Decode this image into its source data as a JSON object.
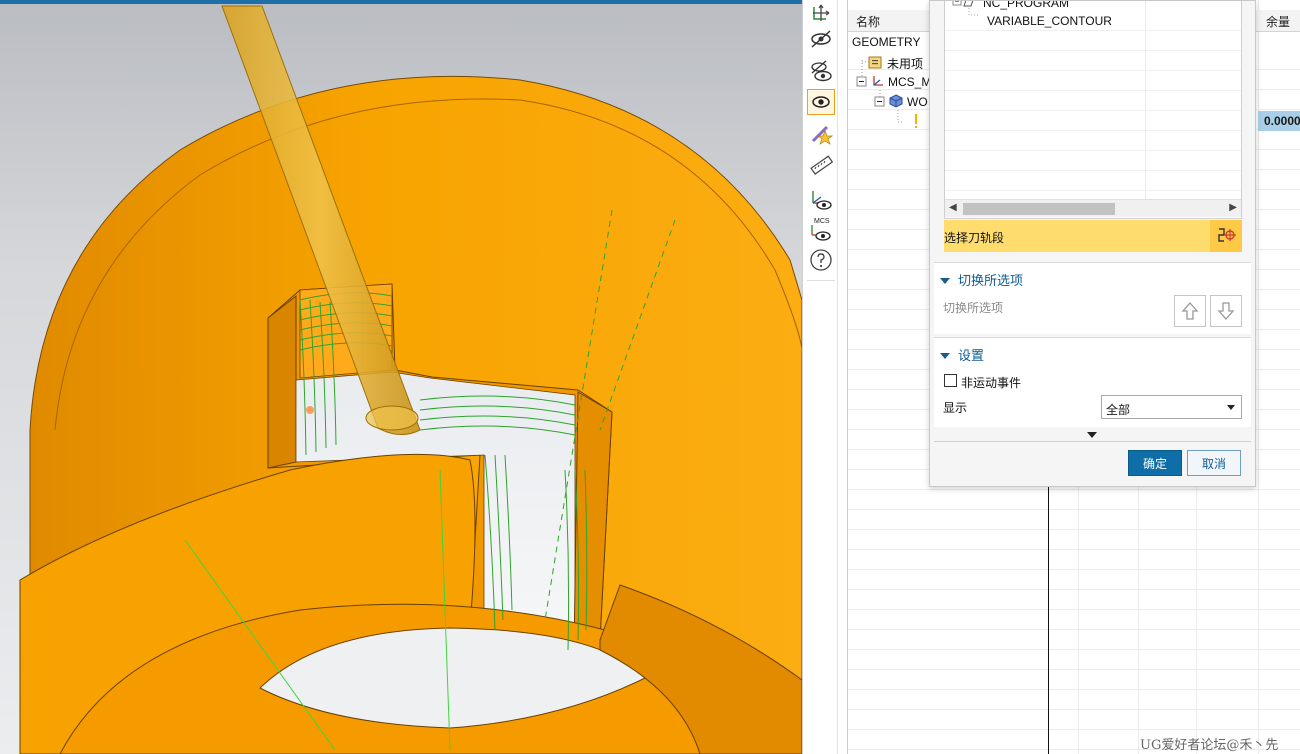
{
  "navigator": {
    "col_name": "名称",
    "col_remain": "余量",
    "geometry": "GEOMETRY",
    "unused": "未用项",
    "mcs": "MCS_M",
    "workpiece": "WO",
    "remain_value": "0.0000"
  },
  "dialog": {
    "tree_root": "NC_PROGRAM",
    "tree_child": "VARIABLE_CONTOUR",
    "select_label": "选择刀轨段",
    "switch_section_title": "切换所选项",
    "switch_section_sub": "切换所选项",
    "settings_title": "设置",
    "non_motion_label": "非运动事件",
    "display_label": "显示",
    "display_value": "全部",
    "ok": "确定",
    "cancel": "取消"
  },
  "toolbar": {
    "icons": [
      "move-rotate-icon",
      "hide-icon",
      "show-hide-icon",
      "show-icon",
      "star-edit-icon",
      "ruler-icon",
      "axis-show-icon",
      "mcs-show-icon",
      "help-icon"
    ],
    "mcs_label": "MCS"
  },
  "viewport": {
    "part_color": "#f59b00",
    "tool_color": "#e6b634",
    "toolpath_color": "#2fa32f"
  },
  "watermark": "UG爱好者论坛@禾丶先"
}
